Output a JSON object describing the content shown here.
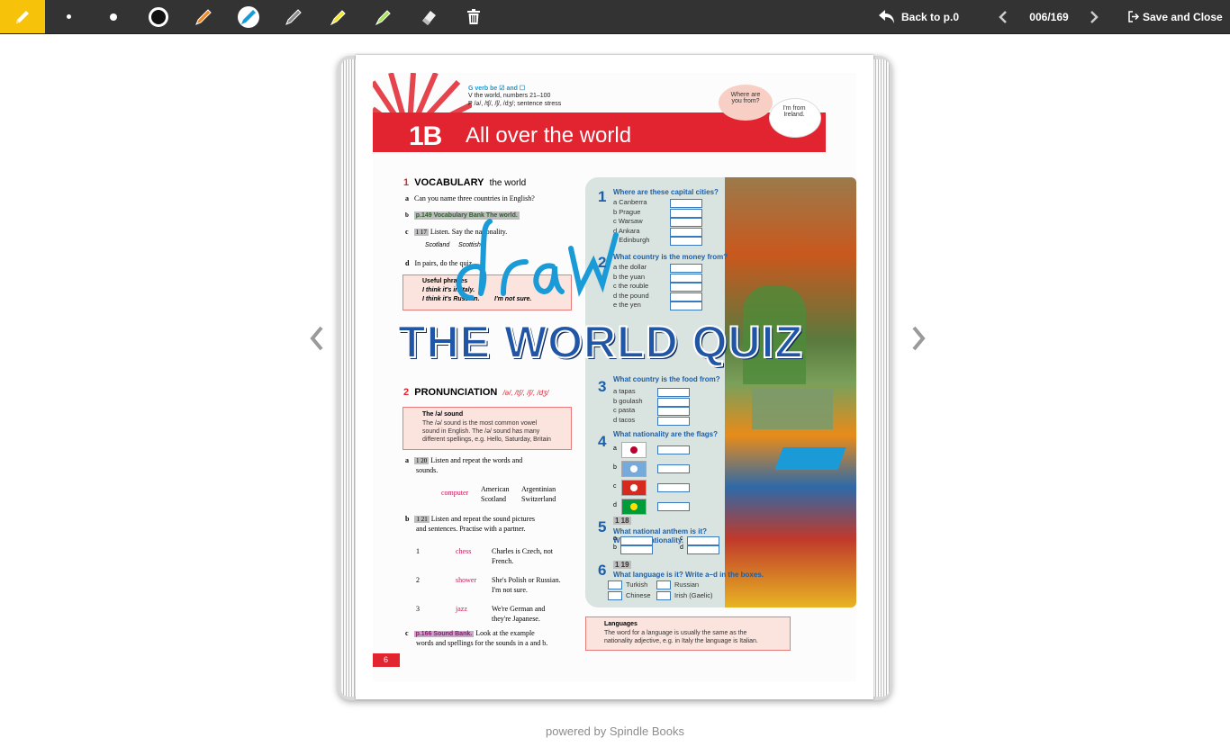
{
  "toolbar": {
    "tools": [
      "highlighter-active",
      "dot-small",
      "dot-medium",
      "dot-large",
      "pencil-orange",
      "pencil-blue",
      "pencil-gray",
      "marker-yellow",
      "marker-green",
      "eraser",
      "trash"
    ],
    "back_label": "Back to p.0",
    "page_counter": "006/169",
    "save_label": "Save and Close"
  },
  "book": {
    "header": {
      "grammar": "G  verb be ☑ and ☐",
      "vocab": "V  the world, numbers 21–100",
      "pron": "P  /ə/, /tʃ/, /ʃ/, /dʒ/; sentence stress",
      "unit": "1B",
      "title": "All over the world",
      "bubble1": "Where are you from?",
      "bubble2": "I'm from Ireland."
    },
    "vocab": {
      "num": "1",
      "title": "VOCABULARY",
      "sub": "the world",
      "a": "Can you name three countries in English?",
      "b": "p.149 Vocabulary Bank The world.",
      "c": "Listen. Say the nationality.",
      "c_ex1": "Scotland",
      "c_ex2": "Scottish",
      "d": "In pairs, do the quiz.",
      "phrases_title": "Useful phrases",
      "phrase1": "I think it's in Italy.",
      "phrase2": "I think it's Russian.",
      "phrase3": "I'm not sure.",
      "audio17": "1 17"
    },
    "draw_text": "draw",
    "quiz_title": "THE WORLD QUIZ",
    "quiz": {
      "q1": "Where are these capital cities?",
      "q1_items": [
        "a  Canberra",
        "b  Prague",
        "c  Warsaw",
        "d  Ankara",
        "e  Edinburgh"
      ],
      "q2": "What country is the money from?",
      "q2_items": [
        "a  the dollar",
        "b  the yuan",
        "c  the rouble",
        "d  the pound",
        "e  the yen"
      ],
      "q3": "What country is the food from?",
      "q3_items": [
        "a  tapas",
        "b  goulash",
        "c  pasta",
        "d  tacos"
      ],
      "q4": "What nationality are the flags?",
      "q4_items": [
        "a",
        "b",
        "c",
        "d"
      ],
      "q5": "What national anthem is it? Write the nationality.",
      "q5_audio": "1 18",
      "q5_items": [
        "a",
        "b",
        "c",
        "d"
      ],
      "q6": "What language is it? Write a–d in the boxes.",
      "q6_audio": "1 19",
      "q6_items": [
        "Turkish",
        "Russian",
        "Chinese",
        "Irish (Gaelic)"
      ],
      "nums": [
        "1",
        "2",
        "3",
        "4",
        "5",
        "6"
      ]
    },
    "pron": {
      "num": "2",
      "title": "PRONUNCIATION",
      "sub": "/ə/, /tʃ/, /ʃ/, /dʒ/",
      "tip_title": "The /ə/ sound",
      "tip_body1": "The /ə/ sound is the most common vowel",
      "tip_body2": "sound in English. The /ə/ sound has many",
      "tip_body3": "different spellings, e.g. Hello, Saturday, Britain",
      "a": "Listen and repeat the words and",
      "a2": "sounds.",
      "a_audio": "1 20",
      "word_computer": "computer",
      "words_col1": [
        "American",
        "Scotland"
      ],
      "words_col2": [
        "Argentinian",
        "Switzerland"
      ],
      "b": "Listen and repeat the sound pictures",
      "b2": "and sentences. Practise with a partner.",
      "b_audio": "1 21",
      "rows": [
        {
          "n": "1",
          "word": "chess",
          "s1": "Charles is Czech, not",
          "s2": "French."
        },
        {
          "n": "2",
          "word": "shower",
          "s1": "She's Polish or Russian.",
          "s2": "I'm not sure."
        },
        {
          "n": "3",
          "word": "jazz",
          "s1": "We're German and",
          "s2": "they're Japanese."
        }
      ],
      "c": "p.166 Sound Bank.",
      "c_rest": "Look at the example",
      "c2": "words and spellings for the sounds in a and b."
    },
    "languages_title": "Languages",
    "languages_body1": "The word for a language is usually the same as the",
    "languages_body2": "nationality adjective, e.g. in Italy the language is Italian.",
    "page_number": "6"
  },
  "footer": "powered by Spindle Books",
  "colors": {
    "toolbar": "#333333",
    "active": "#f7c30a",
    "red": "#e1242f",
    "blue": "#1e5fa8",
    "ink": "#1a9bd7"
  }
}
